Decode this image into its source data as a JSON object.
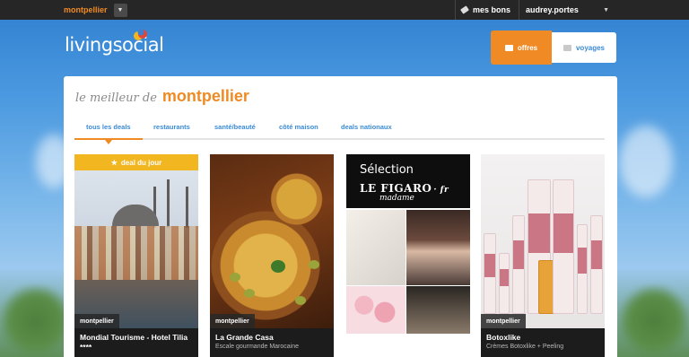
{
  "topbar": {
    "city": "montpellier",
    "mes_bons": "mes bons",
    "user": "audrey.portes"
  },
  "logo": {
    "text": "livingsocial"
  },
  "nav": {
    "offres": "offres",
    "voyages": "voyages"
  },
  "headline": {
    "prefix": "le meilleur de",
    "city": "montpellier"
  },
  "categories": [
    {
      "label": "tous les deals",
      "active": true
    },
    {
      "label": "restaurants",
      "active": false
    },
    {
      "label": "santé/beauté",
      "active": false
    },
    {
      "label": "côté maison",
      "active": false
    },
    {
      "label": "deals nationaux",
      "active": false
    }
  ],
  "deals": [
    {
      "ribbon": "deal du jour",
      "city": "montpellier",
      "title": "Mondial Tourisme - Hotel Tilia ****",
      "subtitle": ""
    },
    {
      "city": "montpellier",
      "title": "La Grande Casa",
      "subtitle": "Escale gourmande Marocaine"
    },
    {
      "promo_heading": "Sélection",
      "promo_brand": "LE FIGARO",
      "promo_brand_suffix": "· fr",
      "promo_sub": "madame"
    },
    {
      "city": "montpellier",
      "title": "Botoxlike",
      "subtitle": "Crèmes Botoxlike + Peeling"
    }
  ],
  "colors": {
    "accent": "#f08a24",
    "link": "#3a8bd6",
    "ribbon": "#f2b620",
    "topbar": "#262626"
  }
}
